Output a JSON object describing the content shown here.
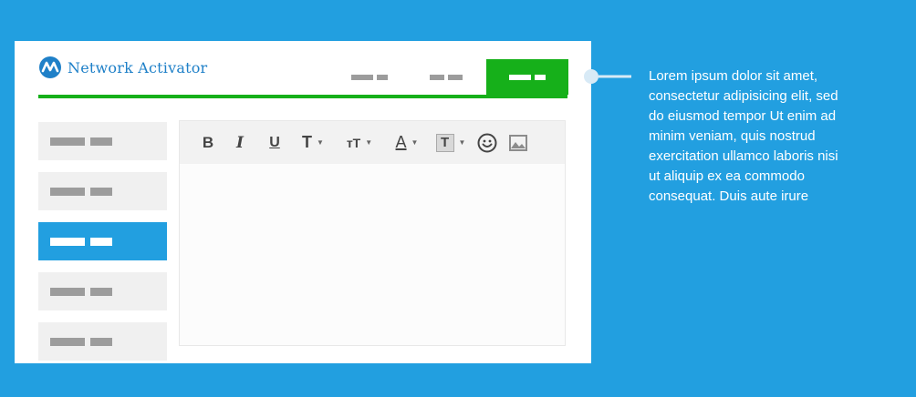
{
  "brand": {
    "name": "Network Activator",
    "logo_icon": "network-activator-logo",
    "logo_color": "#1f80c8"
  },
  "colors": {
    "background": "#229fe0",
    "accent_green": "#16b01a",
    "accent_blue": "#229fe0",
    "placeholder_gray": "#9c9c9c"
  },
  "topnav": {
    "tabs": [
      {
        "label": "",
        "active": false
      },
      {
        "label": "",
        "active": false
      },
      {
        "label": "",
        "active": true
      }
    ]
  },
  "sidebar": {
    "items": [
      {
        "label": "",
        "active": false
      },
      {
        "label": "",
        "active": false
      },
      {
        "label": "",
        "active": true
      },
      {
        "label": "",
        "active": false
      },
      {
        "label": "",
        "active": false
      }
    ]
  },
  "editor": {
    "toolbar": {
      "bold": "B",
      "italic": "I",
      "underline": "U",
      "text_type": "T",
      "font_size": "тT",
      "font_color": "A",
      "text_background": "T",
      "emoji_icon": "emoji-icon",
      "image_icon": "image-icon"
    },
    "content": ""
  },
  "description": "Lorem ipsum dolor sit amet, consectetur adipisicing elit, sed do eiusmod tempor Ut enim ad minim veniam, quis nostrud exercitation ullamco laboris nisi ut aliquip ex ea commodo consequat. Duis aute irure"
}
